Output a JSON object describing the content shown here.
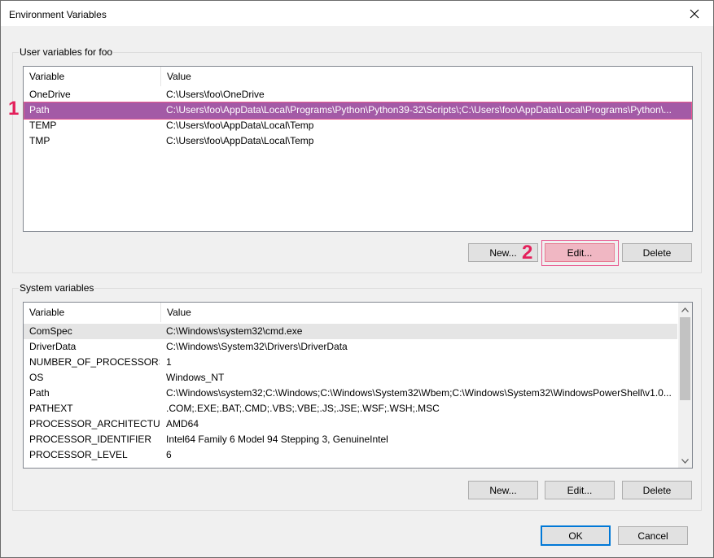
{
  "window": {
    "title": "Environment Variables"
  },
  "user_vars": {
    "group_label": "User variables for foo",
    "columns": {
      "variable": "Variable",
      "value": "Value"
    },
    "rows": [
      {
        "variable": "OneDrive",
        "value": "C:\\Users\\foo\\OneDrive"
      },
      {
        "variable": "Path",
        "value": "C:\\Users\\foo\\AppData\\Local\\Programs\\Python\\Python39-32\\Scripts\\;C:\\Users\\foo\\AppData\\Local\\Programs\\Python\\..."
      },
      {
        "variable": "TEMP",
        "value": "C:\\Users\\foo\\AppData\\Local\\Temp"
      },
      {
        "variable": "TMP",
        "value": "C:\\Users\\foo\\AppData\\Local\\Temp"
      }
    ],
    "buttons": {
      "new": "New...",
      "edit": "Edit...",
      "delete": "Delete"
    }
  },
  "system_vars": {
    "group_label": "System variables",
    "columns": {
      "variable": "Variable",
      "value": "Value"
    },
    "rows": [
      {
        "variable": "ComSpec",
        "value": "C:\\Windows\\system32\\cmd.exe"
      },
      {
        "variable": "DriverData",
        "value": "C:\\Windows\\System32\\Drivers\\DriverData"
      },
      {
        "variable": "NUMBER_OF_PROCESSORS",
        "value": "1"
      },
      {
        "variable": "OS",
        "value": "Windows_NT"
      },
      {
        "variable": "Path",
        "value": "C:\\Windows\\system32;C:\\Windows;C:\\Windows\\System32\\Wbem;C:\\Windows\\System32\\WindowsPowerShell\\v1.0..."
      },
      {
        "variable": "PATHEXT",
        "value": ".COM;.EXE;.BAT;.CMD;.VBS;.VBE;.JS;.JSE;.WSF;.WSH;.MSC"
      },
      {
        "variable": "PROCESSOR_ARCHITECTURE",
        "value": "AMD64"
      },
      {
        "variable": "PROCESSOR_IDENTIFIER",
        "value": "Intel64 Family 6 Model 94 Stepping 3, GenuineIntel"
      },
      {
        "variable": "PROCESSOR_LEVEL",
        "value": "6"
      }
    ],
    "buttons": {
      "new": "New...",
      "edit": "Edit...",
      "delete": "Delete"
    }
  },
  "dialog_buttons": {
    "ok": "OK",
    "cancel": "Cancel"
  },
  "annotations": {
    "marker_1": "1",
    "marker_2": "2"
  },
  "colors": {
    "selection": "#a35aa6",
    "annotation": "#e4205b",
    "default_button_border": "#0078d7"
  }
}
